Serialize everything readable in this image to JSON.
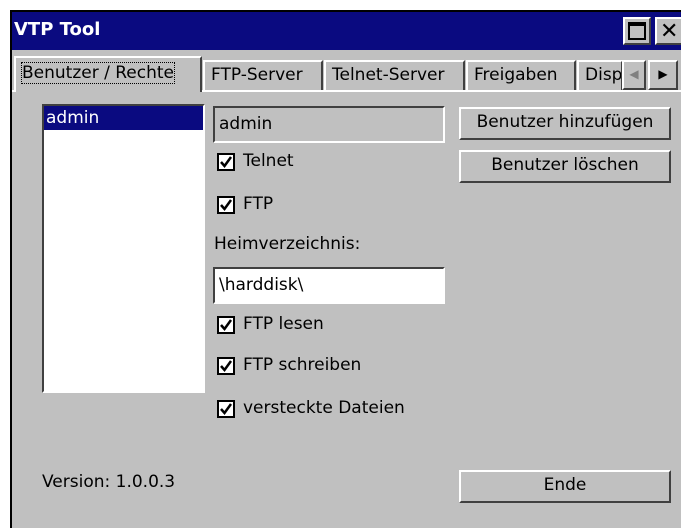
{
  "window": {
    "title": "VTP Tool"
  },
  "tabs": [
    {
      "label": "Benutzer / Rechte"
    },
    {
      "label": "FTP-Server"
    },
    {
      "label": "Telnet-Server"
    },
    {
      "label": "Freigaben"
    },
    {
      "label": "Disp"
    }
  ],
  "users": {
    "items": [
      "admin"
    ],
    "selected": "admin"
  },
  "form": {
    "username_value": "admin",
    "telnet": {
      "label": "Telnet",
      "checked": true
    },
    "ftp": {
      "label": "FTP",
      "checked": true
    },
    "home_label": "Heimverzeichnis:",
    "home_value": "\\harddisk\\",
    "ftp_read": {
      "label": "FTP lesen",
      "checked": true
    },
    "ftp_write": {
      "label": "FTP schreiben",
      "checked": true
    },
    "hidden_files": {
      "label": "versteckte Dateien",
      "checked": true
    }
  },
  "buttons": {
    "add_user": "Benutzer hinzufügen",
    "delete_user": "Benutzer löschen",
    "end": "Ende"
  },
  "version_text": "Version: 1.0.0.3",
  "colors": {
    "titlebar": "#0a0a80",
    "face": "#c0c0c0",
    "selection": "#0a0a80"
  },
  "icons": {
    "maximize": "maximize-icon",
    "close": "close-icon",
    "scroll_left": "arrow-left-icon",
    "scroll_right": "arrow-right-icon",
    "check": "checkmark-icon"
  }
}
